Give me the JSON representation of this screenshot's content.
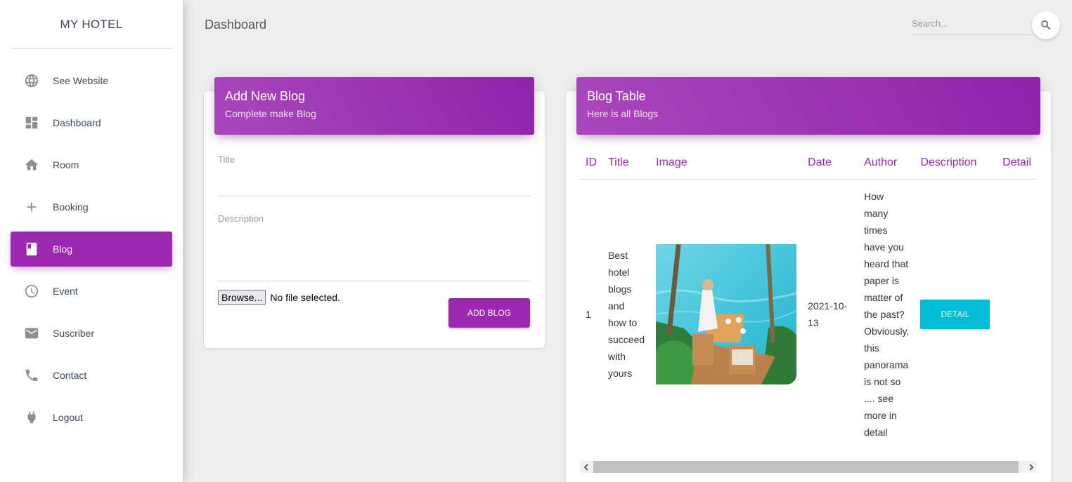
{
  "brand": "MY HOTEL",
  "sidebar": {
    "items": [
      {
        "label": "See Website",
        "icon": "globe-icon"
      },
      {
        "label": "Dashboard",
        "icon": "dashboard-icon"
      },
      {
        "label": "Room",
        "icon": "home-icon"
      },
      {
        "label": "Booking",
        "icon": "plus-icon"
      },
      {
        "label": "Blog",
        "icon": "book-icon",
        "active": true
      },
      {
        "label": "Event",
        "icon": "clock-icon"
      },
      {
        "label": "Suscriber",
        "icon": "mail-icon"
      },
      {
        "label": "Contact",
        "icon": "phone-icon"
      },
      {
        "label": "Logout",
        "icon": "power-plug-icon"
      }
    ]
  },
  "header": {
    "title": "Dashboard",
    "search_placeholder": "Search..."
  },
  "form_card": {
    "title": "Add New Blog",
    "subtitle": "Complete make Blog",
    "title_label": "Title",
    "description_label": "Description",
    "browse_label": "Browse...",
    "file_status": "No file selected.",
    "submit_label": "ADD BLOG"
  },
  "table_card": {
    "title": "Blog Table",
    "subtitle": "Here is all Blogs",
    "columns": [
      "ID",
      "Title",
      "Image",
      "Date",
      "Author",
      "Description",
      "Detail"
    ],
    "rows": [
      {
        "id": "1",
        "title": "Best hotel blogs and how to succeed with yours",
        "image": "hotel-pool-dining-photo",
        "date": "2021-10-13",
        "author": "How many times have you heard that paper is matter of the past? Obviously, this panorama is not so .... see more in detail",
        "detail_label": "DETAIL"
      }
    ]
  },
  "colors": {
    "primary": "#9c27b0",
    "info": "#00bcd4",
    "background": "#eeeeee"
  }
}
